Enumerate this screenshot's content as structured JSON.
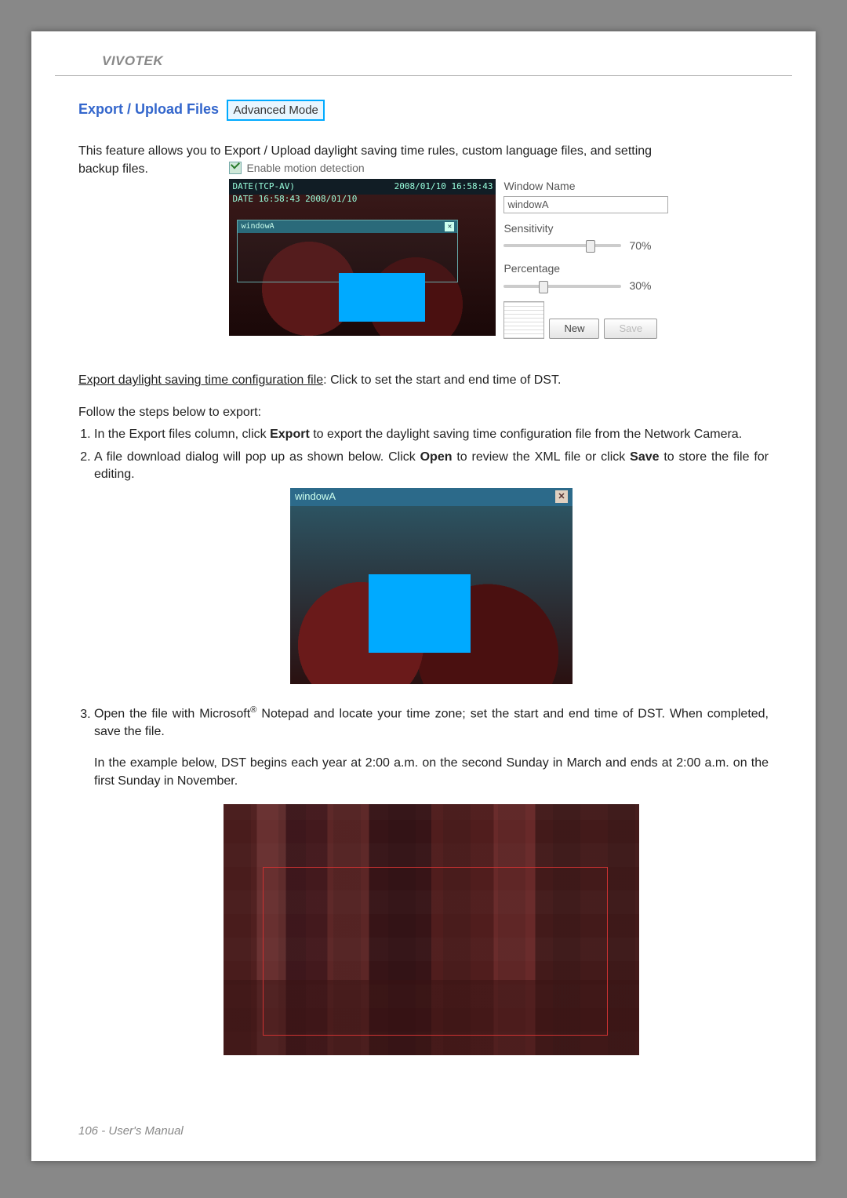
{
  "header": {
    "brand": "VIVOTEK"
  },
  "section": {
    "title": "Export / Upload Files",
    "badge": "Advanced Mode",
    "intro_line1": "This feature allows you to Export / Upload daylight saving time rules, custom language files, and setting",
    "intro_line2": "backup files."
  },
  "ui1": {
    "enable_label": "Enable motion detection",
    "video": {
      "top_left": "DATE(TCP-AV)",
      "top_right": "2008/01/10 16:58:43",
      "date_line": "DATE 16:58:43 2008/01/10",
      "win_name": "windowA"
    },
    "side": {
      "window_name_label": "Window Name",
      "window_name_value": "windowA",
      "sensitivity_label": "Sensitivity",
      "sensitivity_value": "70%",
      "sensitivity_pos_pct": 70,
      "percentage_label": "Percentage",
      "percentage_value": "30%",
      "percentage_pos_pct": 30,
      "btn_new": "New",
      "btn_save": "Save"
    }
  },
  "body": {
    "export_dst_label": "Export daylight saving time configuration file",
    "export_dst_desc": ": Click to set the start and end time of DST.",
    "follow_steps": "Follow the steps below to export:",
    "step1_a": "In the Export files column, click ",
    "step1_b": "Export",
    "step1_c": " to export the daylight saving time configuration file from the Network Camera.",
    "step2_a": "A file download dialog will pop up as shown below. Click ",
    "step2_b": "Open",
    "step2_c": " to review the XML file or click ",
    "step2_d": "Save",
    "step2_e": " to store the file for editing.",
    "step3_a": "Open the file with Microsoft",
    "step3_sup": "®",
    "step3_b": " Notepad and locate your time zone; set the start and end time of DST. When completed, save the file.",
    "example": "In the example below, DST begins each year at 2:00 a.m. on the second Sunday in March and ends at 2:00 a.m. on the first Sunday in November."
  },
  "ui2": {
    "title": "windowA"
  },
  "footer": {
    "page": "106 - User's Manual"
  }
}
